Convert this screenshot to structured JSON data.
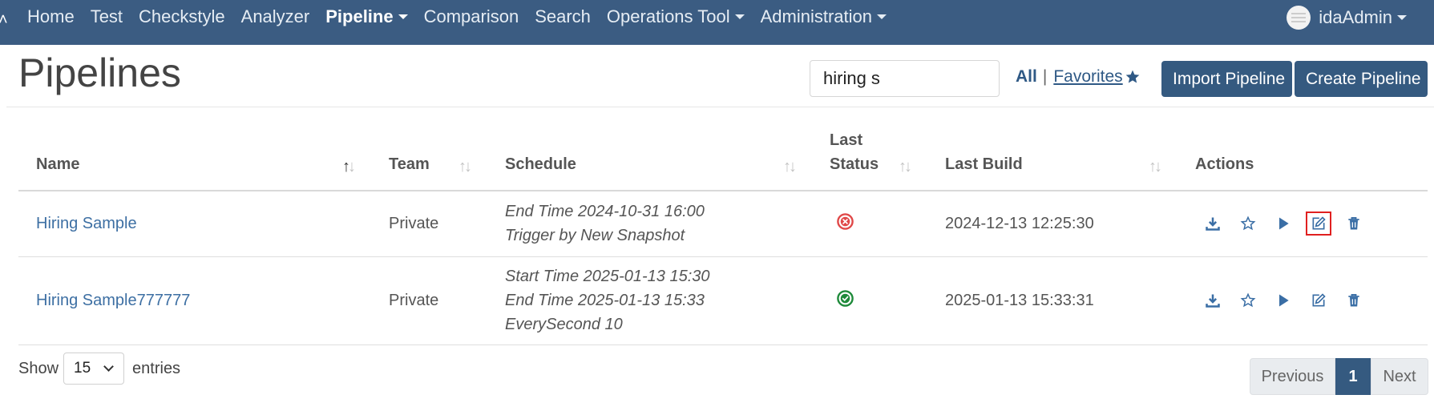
{
  "navbar": {
    "items": [
      {
        "label": "Home",
        "dropdown": false,
        "active": false
      },
      {
        "label": "Test",
        "dropdown": false,
        "active": false
      },
      {
        "label": "Checkstyle",
        "dropdown": false,
        "active": false
      },
      {
        "label": "Analyzer",
        "dropdown": false,
        "active": false
      },
      {
        "label": "Pipeline",
        "dropdown": true,
        "active": true
      },
      {
        "label": "Comparison",
        "dropdown": false,
        "active": false
      },
      {
        "label": "Search",
        "dropdown": false,
        "active": false
      },
      {
        "label": "Operations Tool",
        "dropdown": true,
        "active": false
      },
      {
        "label": "Administration",
        "dropdown": true,
        "active": false
      }
    ],
    "user": "idaAdmin"
  },
  "page": {
    "title": "Pipelines",
    "search_value": "hiring s",
    "filter_all": "All",
    "filter_sep": "|",
    "filter_favorites": "Favorites",
    "import_button": "Import Pipeline",
    "create_button": "Create Pipeline"
  },
  "table": {
    "headers": {
      "name": "Name",
      "team": "Team",
      "schedule": "Schedule",
      "last_status": "Last Status",
      "last_build": "Last Build",
      "actions": "Actions"
    },
    "rows": [
      {
        "name": "Hiring Sample",
        "team": "Private",
        "schedule": [
          "End Time 2024-10-31 16:00",
          "Trigger by New Snapshot"
        ],
        "status": "failed",
        "last_build": "2024-12-13 12:25:30"
      },
      {
        "name": "Hiring Sample777777",
        "team": "Private",
        "schedule": [
          "Start Time 2025-01-13 15:30",
          "End Time 2025-01-13 15:33",
          "EverySecond 10"
        ],
        "status": "success",
        "last_build": "2025-01-13 15:33:31"
      }
    ]
  },
  "footer": {
    "show_label": "Show",
    "entries_value": "15",
    "entries_label": "entries",
    "prev": "Previous",
    "page": "1",
    "next": "Next"
  },
  "colors": {
    "navbar": "#3b5c82",
    "primary": "#355a80",
    "link": "#3d6fa3",
    "danger": "#e04848",
    "success": "#1e8a3a",
    "highlight": "#e02020"
  },
  "icons": {
    "row_actions": [
      "download-icon",
      "star-icon",
      "play-icon",
      "edit-icon",
      "trash-icon"
    ]
  }
}
